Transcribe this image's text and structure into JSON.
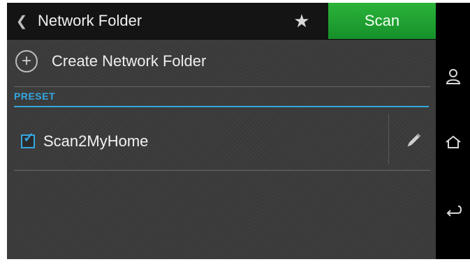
{
  "header": {
    "back_icon": "chevron-left-icon",
    "title": "Network Folder",
    "favorite_icon": "star-icon",
    "scan_label": "Scan"
  },
  "create": {
    "icon": "plus-circle-icon",
    "label": "Create Network Folder"
  },
  "preset": {
    "section_label": "PRESET",
    "items": [
      {
        "label": "Scan2MyHome",
        "checked": true,
        "edit_icon": "pencil-icon"
      }
    ]
  },
  "side_nav": {
    "buttons": [
      {
        "icon": "user-icon"
      },
      {
        "icon": "home-icon"
      },
      {
        "icon": "back-arrow-icon"
      }
    ]
  },
  "colors": {
    "accent": "#35a7e0",
    "scan_green": "#1e9e2d",
    "background": "#3a3a3a",
    "topbar": "#141414"
  }
}
